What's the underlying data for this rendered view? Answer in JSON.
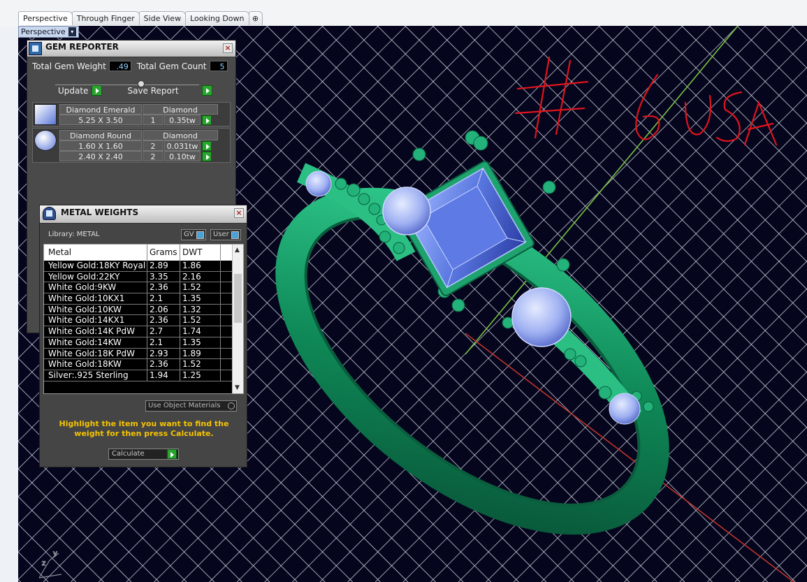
{
  "tabs": [
    {
      "label": "Perspective",
      "active": true
    },
    {
      "label": "Through Finger",
      "active": false
    },
    {
      "label": "Side View",
      "active": false
    },
    {
      "label": "Looking Down",
      "active": false
    },
    {
      "label": "⊕",
      "active": false
    }
  ],
  "viewport": {
    "label": "Perspective",
    "dropdown_glyph": "▾",
    "annotation_text": "# 6 USA"
  },
  "gem_reporter": {
    "title": "GEM REPORTER",
    "close": "×",
    "total_weight_label": "Total Gem Weight",
    "total_weight_value": ".49",
    "total_count_label": "Total Gem Count",
    "total_count_value": "5",
    "update_label": "Update",
    "save_label": "Save Report",
    "gems": [
      {
        "shape": "Diamond Emerald",
        "type": "Diamond",
        "sizes": [
          {
            "size": "5.25 X 3.50",
            "count": "1",
            "weight": "0.35tw"
          }
        ]
      },
      {
        "shape": "Diamond Round",
        "type": "Diamond",
        "sizes": [
          {
            "size": "1.60 X 1.60",
            "count": "2",
            "weight": "0.031tw"
          },
          {
            "size": "2.40 X 2.40",
            "count": "2",
            "weight": "0.10tw"
          }
        ]
      }
    ]
  },
  "metal_weights": {
    "title": "METAL WEIGHTS",
    "close": "×",
    "library": "Library: METAL",
    "gv_label": "GV",
    "user_label": "User",
    "columns": [
      "Metal",
      "Grams",
      "DWT"
    ],
    "rows": [
      [
        "Yellow Gold:18KY Royal",
        "2.89",
        "1.86"
      ],
      [
        "Yellow Gold:22KY",
        "3.35",
        "2.16"
      ],
      [
        "White Gold:9KW",
        "2.36",
        "1.52"
      ],
      [
        "White Gold:10KX1",
        "2.1",
        "1.35"
      ],
      [
        "White Gold:10KW",
        "2.06",
        "1.32"
      ],
      [
        "White Gold:14KX1",
        "2.36",
        "1.52"
      ],
      [
        "White Gold:14K PdW",
        "2.7",
        "1.74"
      ],
      [
        "White Gold:14KW",
        "2.1",
        "1.35"
      ],
      [
        "White Gold:18K PdW",
        "2.93",
        "1.89"
      ],
      [
        "White Gold:18KW",
        "2.36",
        "1.52"
      ],
      [
        "Silver:.925 Sterling",
        "1.94",
        "1.25"
      ]
    ],
    "use_object_label": "Use Object Materials",
    "hint": "Highlight the item you want to find the weight for then press Calculate.",
    "calculate_label": "Calculate"
  },
  "colors": {
    "viewport_bg": "#05061d",
    "ring_green": "#1aa36a",
    "gem_blue": "#5a78e0",
    "annotation_red": "#e0141e"
  }
}
